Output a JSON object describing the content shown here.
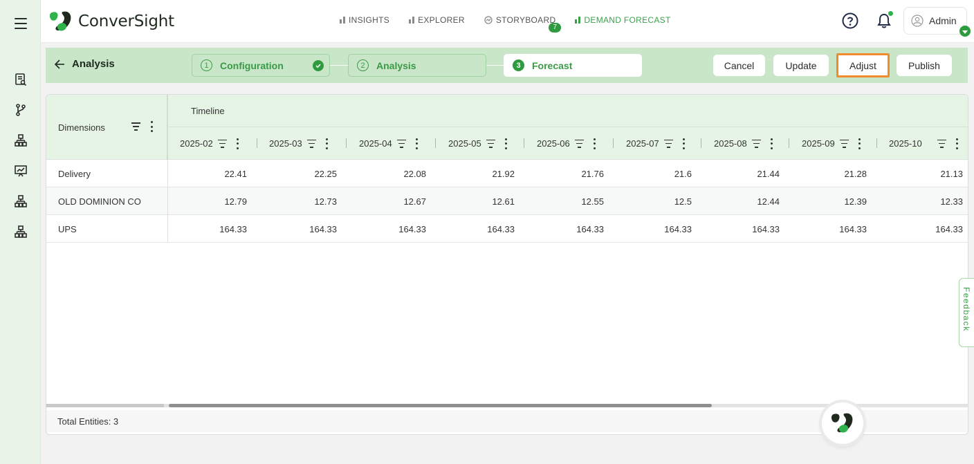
{
  "app": {
    "name": "ConverSight"
  },
  "nav": {
    "items": [
      {
        "label": "INSIGHTS",
        "active": false
      },
      {
        "label": "EXPLORER",
        "active": false
      },
      {
        "label": "STORYBOARD",
        "active": false,
        "badge": "7"
      },
      {
        "label": "DEMAND FORECAST",
        "active": true
      }
    ]
  },
  "header": {
    "user_label": "Admin"
  },
  "sidebar": {
    "icons": [
      "report-icon",
      "branch-icon",
      "hierarchy-icon",
      "presentation-chart-icon",
      "hierarchy-icon",
      "hierarchy-icon"
    ]
  },
  "stepbar": {
    "back_label": "Analysis",
    "steps": [
      {
        "num": "1",
        "label": "Configuration",
        "completed": true
      },
      {
        "num": "2",
        "label": "Analysis",
        "completed": false
      },
      {
        "num": "3",
        "label": "Forecast",
        "current": true
      }
    ],
    "buttons": {
      "cancel": "Cancel",
      "update": "Update",
      "adjust": "Adjust",
      "publish": "Publish"
    }
  },
  "table": {
    "dimensions_header": "Dimensions",
    "group_header": "Timeline",
    "columns": [
      "2025-02",
      "2025-03",
      "2025-04",
      "2025-05",
      "2025-06",
      "2025-07",
      "2025-08",
      "2025-09",
      "2025-10"
    ],
    "rows": [
      {
        "dimension": "Delivery",
        "values": [
          "22.41",
          "22.25",
          "22.08",
          "21.92",
          "21.76",
          "21.6",
          "21.44",
          "21.28",
          "21.13"
        ]
      },
      {
        "dimension": "OLD DOMINION CO",
        "values": [
          "12.79",
          "12.73",
          "12.67",
          "12.61",
          "12.55",
          "12.5",
          "12.44",
          "12.39",
          "12.33"
        ]
      },
      {
        "dimension": "UPS",
        "values": [
          "164.33",
          "164.33",
          "164.33",
          "164.33",
          "164.33",
          "164.33",
          "164.33",
          "164.33",
          "164.33"
        ]
      }
    ],
    "footer": "Total Entities: 3"
  },
  "feedback_label": "Feedback",
  "colors": {
    "brand_green": "#2f9b3f",
    "step_bar": "#c9e6c9",
    "highlight_orange": "#f08a2b"
  }
}
